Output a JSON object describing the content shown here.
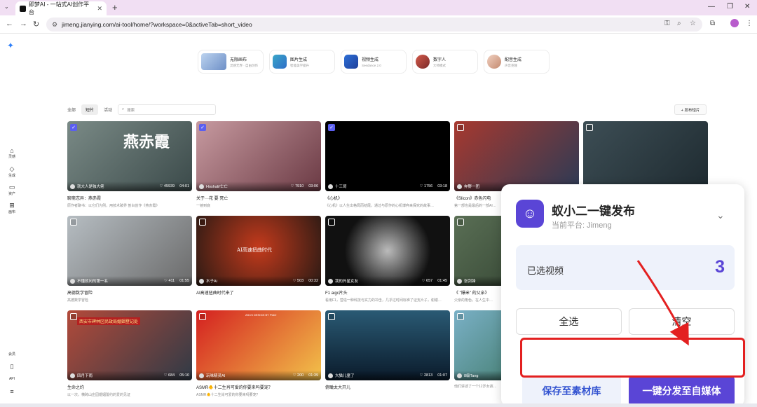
{
  "browser": {
    "tab_title": "即梦AI - 一站式AI创作平台",
    "tab_close": "✕",
    "new_tab": "+",
    "url": "jimeng.jianying.com/ai-tool/home/?workspace=0&activeTab=short_video"
  },
  "tools": [
    {
      "title": "无限画布",
      "sub": "灵感无界 · 自由创作"
    },
    {
      "title": "图片生成",
      "sub": "智能美学提升"
    },
    {
      "title": "视频生成",
      "sub": "Seedance 2.0"
    },
    {
      "title": "数字人",
      "sub": "大师模式"
    },
    {
      "title": "配音生成",
      "sub": "声音克隆"
    }
  ],
  "sidebar": {
    "items": [
      {
        "label": "灵感"
      },
      {
        "label": "生成"
      },
      {
        "label": "资产"
      },
      {
        "label": "画布"
      }
    ],
    "bottom": [
      {
        "label": "会员"
      },
      {
        "label": "API"
      }
    ]
  },
  "filters": {
    "tabs": [
      "全部",
      "短片",
      "活动"
    ],
    "search_placeholder": "搜索",
    "publish_label": "+ 发布短片"
  },
  "cards": [
    {
      "author": "就大人是独大佬",
      "likes": "45939",
      "duration": "04:01",
      "title": "聊斋志异：燕赤霞",
      "desc": "原作者聊书：以它们为例，用技术破界 剖白创作《燕赤霞》",
      "checked": true,
      "overlay": "燕赤霞"
    },
    {
      "author": "Hoshali/亡亡",
      "likes": "7910",
      "duration": "03:06",
      "title": "关于···花 要 死亡",
      "desc": "一镜到底",
      "checked": true,
      "overlay": ""
    },
    {
      "author": "十三哥",
      "likes": "1756",
      "duration": "03:18",
      "title": "《心机》",
      "desc": "《心机》以人生出格局而结尾，通过与原作的心机博弈来探究的故事…",
      "checked": true,
      "overlay": ""
    },
    {
      "author": "奔野一团",
      "likes": "",
      "duration": "",
      "title": "《Slicon》赤色闪电",
      "desc": "第一部也是最后的一部AI…",
      "checked": false,
      "overlay": ""
    },
    {
      "author": "Droplet",
      "likes": "2751",
      "duration": "06:08",
      "title": "",
      "desc": "",
      "checked": false,
      "overlay": ""
    },
    {
      "author": "不懂就问的第一名",
      "likes": "411",
      "duration": "01:55",
      "title": "高德数学冒险",
      "desc": "高德数学冒险",
      "checked": false,
      "overlay": ""
    },
    {
      "author": "木子Ai",
      "likes": "503",
      "duration": "00:32",
      "title": "AI高速扭曲时代来了",
      "desc": "",
      "checked": false,
      "overlay": "AI高速扭曲时代"
    },
    {
      "author": "我的外星女友",
      "likes": "657",
      "duration": "01:45",
      "title": "F1 aigc片头",
      "desc": "看用F1，营造一种科技与实力的冲击，几乎过时间标准了证支片子，谢谢…",
      "checked": false,
      "overlay": ""
    },
    {
      "author": "张剑锋",
      "likes": "",
      "duration": "",
      "title": "《 \"爆米\" 的父亲》",
      "desc": "父亲的角色，在人生中…",
      "checked": false,
      "overlay": ""
    },
    {
      "author": "四月下雨",
      "likes": "684",
      "duration": "05:10",
      "title": "生命之约",
      "desc": "以一次，横跨山庄园婚姻誓约的爱的见证",
      "checked": false,
      "overlay": "西安市碑林区民政局婚姻登记处"
    },
    {
      "author": "玩味精灵AI",
      "likes": "200",
      "duration": "01:39",
      "title": "ASMR🐥十二生肖可爱的你要来吗要宠？",
      "desc": "ASMR🐥十二生肖可爱的你要来吗要宠？",
      "checked": false,
      "overlay": "ASCS DESIGN BY PIAO"
    },
    {
      "author": "大猫儿童了",
      "likes": "2813",
      "duration": "01:07",
      "title": "俯瞰太大开儿",
      "desc": "",
      "checked": false,
      "overlay": ""
    },
    {
      "author": "8级Tang",
      "likes": "",
      "duration": "",
      "title": "",
      "desc": "他们讲述了一个12岁女孩…",
      "checked": false,
      "overlay": ""
    }
  ],
  "panel": {
    "title": "蚁小二一键发布",
    "platform": "当前平台: Jimeng",
    "selected_label": "已选视频",
    "selected_count": "3",
    "select_all": "全选",
    "clear": "清空",
    "save": "保存至素材库",
    "publish": "一键分发至自媒体"
  },
  "colors": {
    "accent": "#5a45d6",
    "highlight": "#e32020"
  }
}
